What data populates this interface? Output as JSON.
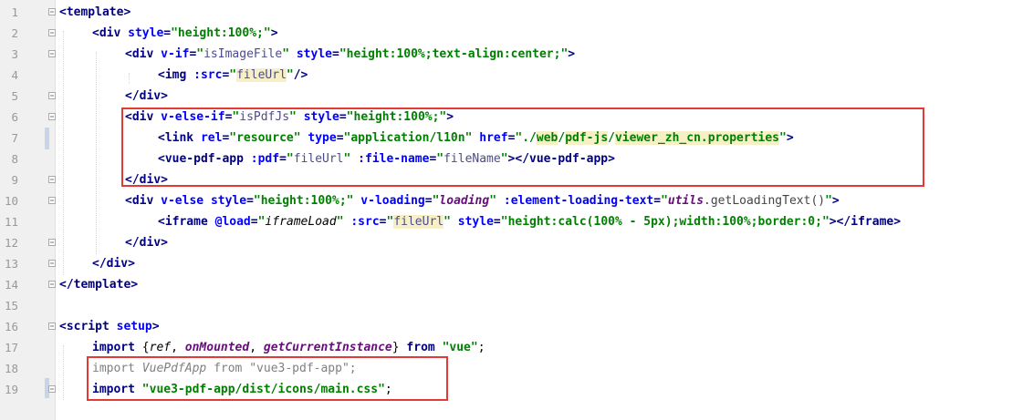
{
  "editor": {
    "line_numbers": [
      "1",
      "2",
      "3",
      "4",
      "5",
      "6",
      "7",
      "8",
      "9",
      "10",
      "11",
      "12",
      "13",
      "14",
      "15",
      "16",
      "17",
      "18",
      "19"
    ],
    "tokens": {
      "l1_tag": "<template>",
      "l2_open": "<div ",
      "l2_a1": "style",
      "l2_eq": "=",
      "l2_v1": "\"height:100%;\"",
      "l2_close": ">",
      "l3_open": "<div ",
      "l3_a1": "v-if",
      "l3_eq": "=",
      "l3_q1": "\"",
      "l3_v1": "isImageFile",
      "l3_q2": "\"",
      "l3_a2": " style",
      "l3_eq2": "=",
      "l3_v2": "\"height:100%;text-align:center;\"",
      "l3_close": ">",
      "l4_open": "<img ",
      "l4_a1": ":src",
      "l4_eq": "=",
      "l4_q1": "\"",
      "l4_v1": "fileUrl",
      "l4_q2": "\"",
      "l4_close": "/>",
      "l5_tag": "</div>",
      "l6_open": "<div ",
      "l6_a1": "v-else-if",
      "l6_eq": "=",
      "l6_q1": "\"",
      "l6_v1": "isPdfJs",
      "l6_q2": "\"",
      "l6_a2": " style",
      "l6_eq2": "=",
      "l6_v2": "\"height:100%;\"",
      "l6_close": ">",
      "l7_open": "<link ",
      "l7_a1": "rel",
      "l7_v1": "\"resource\"",
      "l7_a2": " type",
      "l7_v2": "\"application/l10n\"",
      "l7_a3": " href",
      "l7_v3a": "\"./",
      "l7_v3b": "web",
      "l7_v3c": "/",
      "l7_v3d": "pdf-js",
      "l7_v3e": "/",
      "l7_v3f": "viewer_zh_cn.properties",
      "l7_v3g": "\"",
      "l7_close": ">",
      "l8_open": "<vue-pdf-app ",
      "l8_a1": ":pdf",
      "l8_q1": "\"",
      "l8_v1": "fileUrl",
      "l8_q2": "\"",
      "l8_a2": " :file-name",
      "l8_q3": "\"",
      "l8_v2": "fileName",
      "l8_q4": "\"",
      "l8_close": "></vue-pdf-app>",
      "l9_tag": "</div>",
      "l10_open": "<div ",
      "l10_a1": "v-else ",
      "l10_a2": "style",
      "l10_v1": "\"height:100%;\"",
      "l10_a3": " v-loading",
      "l10_q1": "\"",
      "l10_v2": "loading",
      "l10_q2": "\"",
      "l10_a4": " :element-loading-text",
      "l10_q3": "\"",
      "l10_v3": "utils",
      "l10_dot": ".",
      "l10_fn": "getLoadingText",
      "l10_paren": "()",
      "l10_q4": "\"",
      "l10_close": ">",
      "l11_open": "<iframe ",
      "l11_a1": "@load",
      "l11_q1": "\"",
      "l11_v1": "iframeLoad",
      "l11_q2": "\"",
      "l11_a2": " :src",
      "l11_q3": "\"",
      "l11_v2": "fileUrl",
      "l11_q4": "\"",
      "l11_a3": " style",
      "l11_v3": "\"height:calc(100% - 5px);width:100%;border:0;\"",
      "l11_close": "></iframe>",
      "l12_tag": "</div>",
      "l13_tag": "</div>",
      "l14_tag": "</template>",
      "l16_open": "<script ",
      "l16_a1": "setup",
      "l16_close": ">",
      "l17_kw": "import ",
      "l17_b1": "{",
      "l17_i1": "ref",
      "l17_c1": ", ",
      "l17_i2": "onMounted",
      "l17_c2": ", ",
      "l17_i3": "getCurrentInstance",
      "l17_b2": "}",
      "l17_from": " from ",
      "l17_s": "\"vue\"",
      "l17_semi": ";",
      "l18_kw": "import ",
      "l18_id": "VuePdfApp",
      "l18_from": " from ",
      "l18_s": "\"vue3-pdf-app\"",
      "l18_semi": ";",
      "l19_kw": "import ",
      "l19_s": "\"vue3-pdf-app/dist/icons/main.css\"",
      "l19_semi": ";"
    }
  },
  "annotations": {
    "box_color": "#e53935"
  }
}
